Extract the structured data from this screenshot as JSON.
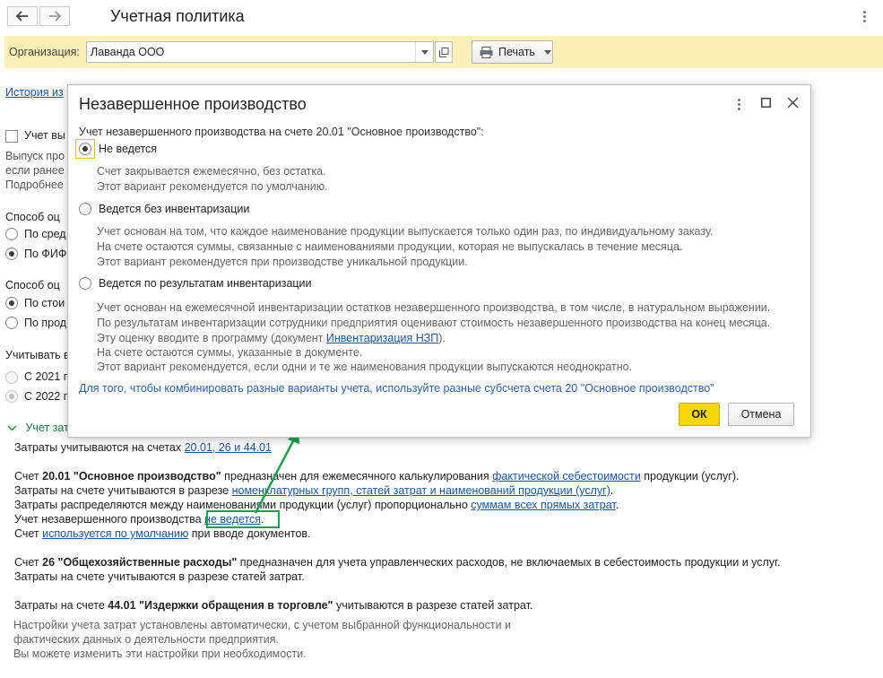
{
  "header": {
    "title": "Учетная политика",
    "back_icon": "arrow-left-icon",
    "forward_icon": "arrow-right-icon"
  },
  "org_bar": {
    "label": "Организация:",
    "value": "Лаванда ООО",
    "print_label": "Печать"
  },
  "background": {
    "history_link": "История из",
    "checkbox_label": "Учет вы",
    "para1_line1": "Выпуск про",
    "para1_line2": "если ранее",
    "para1_line3": "Подробнее",
    "method1_heading": "Способ оц",
    "method1_opt1": "По сред",
    "method1_opt2": "По ФИФ",
    "method2_heading": "Способ оц",
    "method2_opt1": "По стои",
    "method2_opt2": "По прод",
    "account_heading": "Учитывать в",
    "year_opt1": "С 2021 г",
    "year_opt2": "С 2022 г",
    "costs_section": "Учет зат"
  },
  "body": {
    "accounts_prefix": "Затраты учитываются на счетах",
    "accounts_link": "20.01, 26 и 44.01",
    "acc20_a": "Счет",
    "acc20_b": "20.01 \"Основное производство\"",
    "acc20_c": "предназначен для ежемесячного калькулирования",
    "acc20_link": "фактической себестоимости",
    "acc20_d": "продукции (услуг).",
    "line2_a": "Затраты на счете учитываются в разрезе",
    "line2_link": "номенклатурных групп, статей затрат и наименований продукции (услуг)",
    "line2_b": ".",
    "line3_a": "Затраты распределяются между наименованиями продукции (услуг) пропорционально",
    "line3_link": "суммам всех прямых затрат",
    "line3_b": ".",
    "line4_a": "Учет незавершенного производства",
    "line4_link": "не ведется",
    "line4_b": ".",
    "line5_a": "Счет",
    "line5_link": "используется по умолчанию",
    "line5_b": "при вводе документов.",
    "acc26_a": "Счет",
    "acc26_b": "26 \"Общехозяйственные расходы\"",
    "acc26_c": "предназначен для учета управленческих расходов, не включаемых в себестоимость продукции и услуг.",
    "acc26_line2": "Затраты на счете учитываются в разрезе статей затрат.",
    "acc44_a": "Затраты на счете",
    "acc44_b": "44.01 \"Издержки обращения в торговле\"",
    "acc44_c": "учитываются в разрезе статей затрат.",
    "note1": "Настройки учета затрат установлены автоматически, с учетом выбранной функциональности и",
    "note2": "фактических данных о деятельности предприятия.",
    "note3": "Вы можете изменить эти настройки при необходимости."
  },
  "modal": {
    "title": "Незавершенное производство",
    "question": "Учет незавершенного производства на счете 20.01 \"Основное производство\":",
    "opt1_label": "Не ведется",
    "opt1_desc1": "Счет закрывается ежемесячно, без остатка.",
    "opt1_desc2": "Этот вариант рекомендуется по умолчанию.",
    "opt2_label": "Ведется без инвентаризации",
    "opt2_desc1": "Учет основан на том, что каждое наименование продукции выпускается только один раз, по индивидуальному заказу.",
    "opt2_desc2": "На счете остаются суммы, связанные с наименованиями продукции, которая не выпускалась в течение месяца.",
    "opt2_desc3": "Этот вариант рекомендуется при производстве уникальной продукции.",
    "opt3_label": "Ведется по результатам инвентаризации",
    "opt3_desc1": "Учет основан на ежемесячной инвентаризации остатков незавершенного производства, в том числе, в натуральном выражении.",
    "opt3_desc2": "По результатам инвентаризации сотрудники предприятия оценивают стоимость незавершенного производства на конец месяца.",
    "opt3_desc3_a": "Эту оценку вводите в программу (документ",
    "opt3_desc3_link": "Инвентаризация НЗП",
    "opt3_desc3_b": ").",
    "opt3_desc4": "На счете остаются суммы, указанные в документе.",
    "opt3_desc5": "Этот вариант рекомендуется, если одни и те же наименования продукции выпускаются неоднократно.",
    "hint": "Для того, чтобы комбинировать разные варианты учета, используйте разные субсчета счета 20 \"Основное производство\"",
    "ok_label": "ОК",
    "cancel_label": "Отмена",
    "selected_option": 1
  },
  "colors": {
    "accent_yellow": "#f7d800",
    "org_bar": "#fbf0b5",
    "link": "#1a56a8",
    "highlight_green": "#1aa34a"
  }
}
